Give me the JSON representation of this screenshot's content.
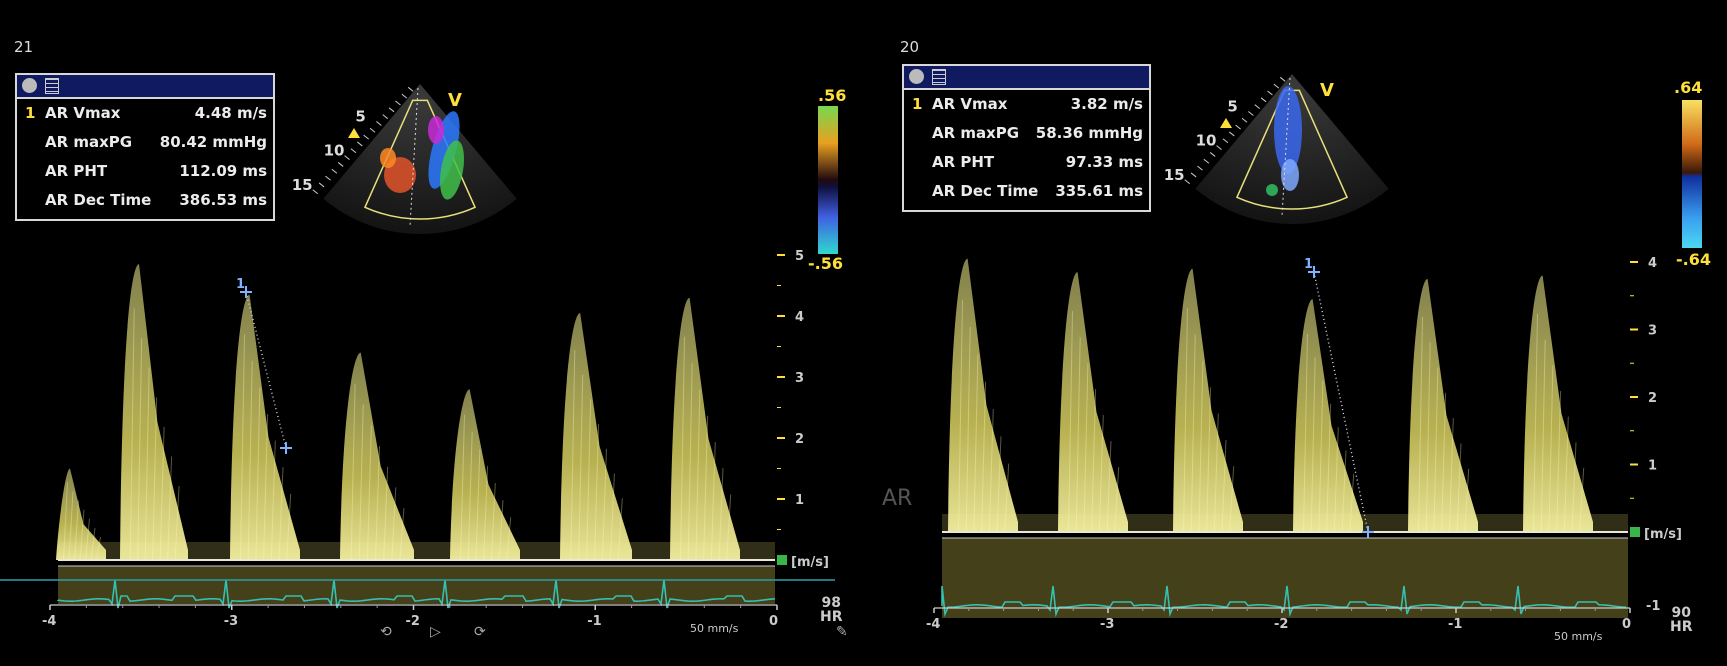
{
  "left": {
    "frame_number": "21",
    "measurements": [
      {
        "index": "1",
        "label": "AR Vmax",
        "value": "4.48 m/s"
      },
      {
        "index": "",
        "label": "AR maxPG",
        "value": "80.42 mmHg"
      },
      {
        "index": "",
        "label": "AR PHT",
        "value": "112.09 ms"
      },
      {
        "index": "",
        "label": "AR Dec Time",
        "value": "386.53 ms"
      }
    ],
    "colorbar_top": ".56",
    "colorbar_bottom": "-.56",
    "velocity_ticks": [
      "5",
      "4",
      "3",
      "2",
      "1"
    ],
    "velocity_unit": "[m/s]",
    "time_ticks": [
      "-4",
      "-3",
      "-2",
      "-1",
      "0"
    ],
    "heart_rate": "98",
    "hr_label": "HR",
    "sweep_speed": "50 mm/s",
    "sector_depths": [
      "5",
      "10",
      "15"
    ],
    "sector_marker": "V",
    "caliper_label": "1",
    "peaks_max_velocity_m_s": 4.48
  },
  "right": {
    "frame_number": "20",
    "measurements": [
      {
        "index": "1",
        "label": "AR Vmax",
        "value": "3.82 m/s"
      },
      {
        "index": "",
        "label": "AR maxPG",
        "value": "58.36 mmHg"
      },
      {
        "index": "",
        "label": "AR PHT",
        "value": "97.33 ms"
      },
      {
        "index": "",
        "label": "AR Dec Time",
        "value": "335.61 ms"
      }
    ],
    "colorbar_top": ".64",
    "colorbar_bottom": "-.64",
    "velocity_ticks": [
      "4",
      "3",
      "2",
      "1"
    ],
    "bottom_tick": "-1",
    "velocity_unit": "[m/s]",
    "time_ticks": [
      "-4",
      "-3",
      "-2",
      "-1",
      "0"
    ],
    "heart_rate": "90",
    "hr_label": "HR",
    "sweep_speed": "50 mm/s",
    "sector_depths": [
      "5",
      "10",
      "15"
    ],
    "sector_marker": "V",
    "caliper_label": "1",
    "side_label": "AR",
    "peaks_max_velocity_m_s": 3.82
  },
  "colors": {
    "doppler": "#e8e06a",
    "ecg": "#35c0b0",
    "caliper": "#7fb3ff",
    "label_yellow": "#ffe03a"
  },
  "icons": [
    "camera-icon",
    "report-icon",
    "play-icon",
    "rewind-icon",
    "forward-icon",
    "pencil-icon"
  ]
}
